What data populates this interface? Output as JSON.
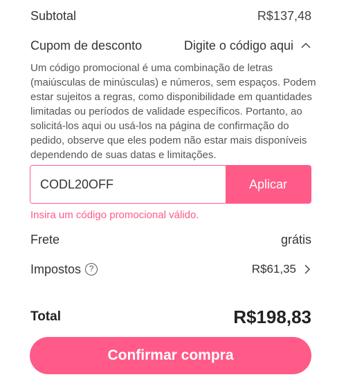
{
  "summary": {
    "subtotal_label": "Subtotal",
    "subtotal_value": "R$137,48",
    "coupon_label": "Cupom de desconto",
    "coupon_toggle_label": "Digite o código aqui",
    "coupon_help": "Um código promocional é uma combinação de letras (maiúsculas de minúsculas) e números, sem espaços. Podem estar sujeitos a regras, como disponibilidade em quantidades limitadas ou períodos de validade específicos. Portanto, ao solicitá-los aqui ou usá-los na página de confirmação do pedido, observe que eles podem não estar mais disponíveis dependendo de suas datas e limitações.",
    "coupon_input_value": "CODL20OFF",
    "apply_label": "Aplicar",
    "coupon_error": "Insira um código promocional válido.",
    "shipping_label": "Frete",
    "shipping_value": "grátis",
    "tax_label": "Impostos",
    "tax_help_glyph": "?",
    "tax_value": "R$61,35",
    "total_label": "Total",
    "total_value": "R$198,83",
    "confirm_label": "Confirmar compra"
  },
  "icons": {
    "coupon_toggle": "chevron-up-icon",
    "tax_help": "question-circle-icon",
    "tax_detail": "chevron-right-icon"
  },
  "colors": {
    "accent": "#ff5a88",
    "text": "#333333"
  }
}
